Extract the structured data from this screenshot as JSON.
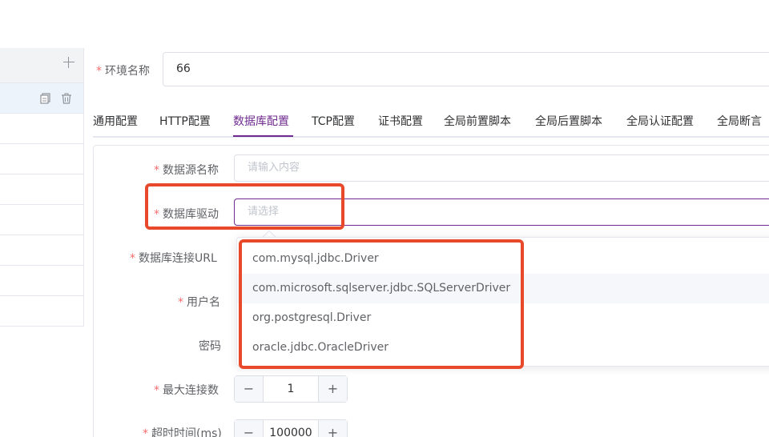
{
  "env": {
    "label": "环境名称",
    "value": "66"
  },
  "tabs": [
    {
      "label": "通用配置"
    },
    {
      "label": "HTTP配置"
    },
    {
      "label": "数据库配置"
    },
    {
      "label": "TCP配置"
    },
    {
      "label": "证书配置"
    },
    {
      "label": "全局前置脚本"
    },
    {
      "label": "全局后置脚本"
    },
    {
      "label": "全局认证配置"
    },
    {
      "label": "全局断言"
    }
  ],
  "form": {
    "datasource_name": {
      "label": "数据源名称",
      "placeholder": "请输入内容"
    },
    "driver": {
      "label": "数据库驱动",
      "placeholder": "请选择"
    },
    "url": {
      "label": "数据库连接URL"
    },
    "username": {
      "label": "用户名"
    },
    "password": {
      "label": "密码"
    },
    "max_connections": {
      "label": "最大连接数",
      "value": "1"
    },
    "timeout": {
      "label": "超时时间(ms)",
      "value": "100000"
    }
  },
  "dropdown": {
    "options": [
      "com.mysql.jdbc.Driver",
      "com.microsoft.sqlserver.jdbc.SQLServerDriver",
      "org.postgresql.Driver",
      "oracle.jdbc.OracleDriver"
    ]
  },
  "colors": {
    "accent": "#6f2b8f",
    "required": "#f56c6c",
    "highlight": "#e8492b"
  }
}
